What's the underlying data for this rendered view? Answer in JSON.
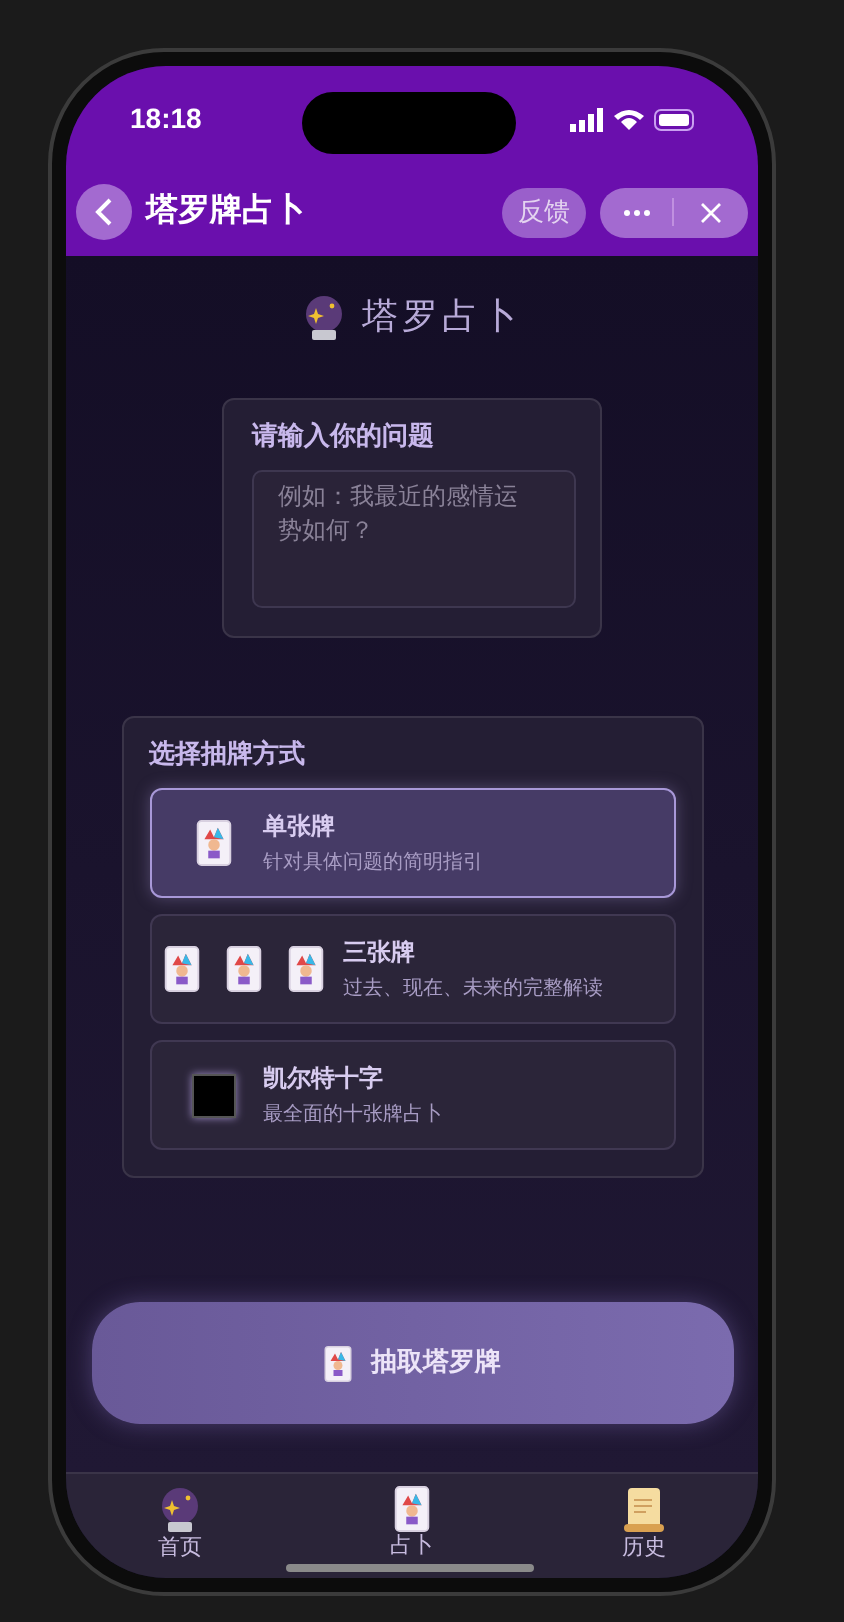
{
  "status_bar": {
    "time": "18:18"
  },
  "nav_bar": {
    "title": "塔罗牌占卜",
    "feedback": "反馈"
  },
  "header": {
    "title": "塔罗占卜"
  },
  "question": {
    "label": "请输入你的问题",
    "placeholder": "例如：我最近的感情运势如何？"
  },
  "spread": {
    "title": "选择抽牌方式",
    "options": [
      {
        "kind": "single",
        "name": "单张牌",
        "description": "针对具体问题的简明指引",
        "selected": true
      },
      {
        "kind": "three",
        "name": "三张牌",
        "description": "过去、现在、未来的完整解读",
        "selected": false
      },
      {
        "kind": "celtic",
        "name": "凯尔特十字",
        "description": "最全面的十张牌占卜",
        "selected": false
      }
    ]
  },
  "draw_button": {
    "label": "抽取塔罗牌"
  },
  "tab_bar": [
    {
      "kind": "home",
      "label": "首页"
    },
    {
      "kind": "divine",
      "label": "占卜"
    },
    {
      "kind": "history",
      "label": "历史"
    }
  ]
}
